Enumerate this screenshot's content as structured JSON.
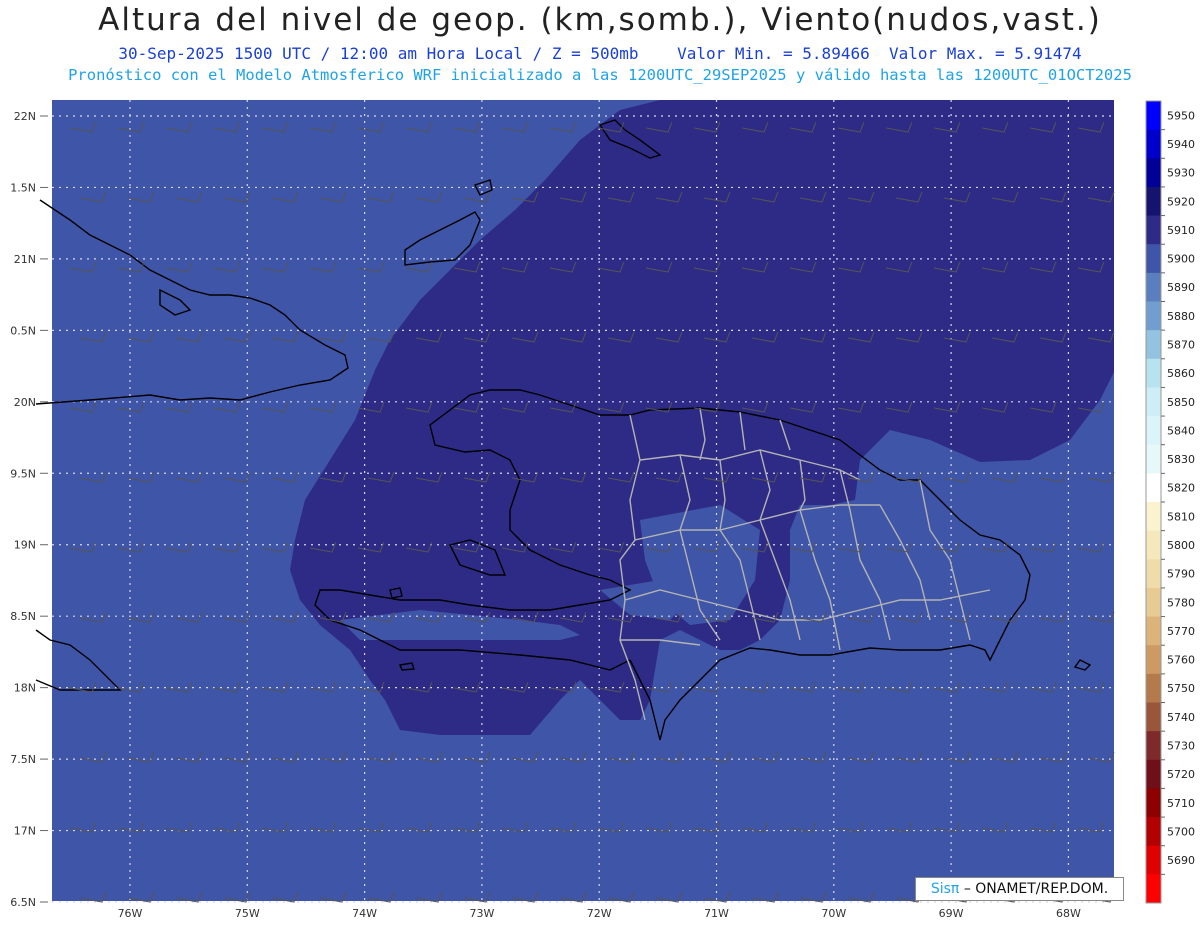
{
  "header": {
    "title": "Altura del nivel de geop. (km,somb.), Viento(nudos,vast.)",
    "subtitle_date": "30-Sep-2025  1500 UTC / 12:00 am Hora Local / Z = 500mb",
    "subtitle_min": "Valor Min. = 5.89466",
    "subtitle_max": "Valor Max. = 5.91474",
    "subtitle_model": "Pronóstico con el Modelo Atmosferico WRF inicializado a las 1200UTC_29SEP2025 y válido hasta las  1200UTC_01OCT2025"
  },
  "axes": {
    "lat_labels": [
      "22N",
      "1.5N",
      "21N",
      "0.5N",
      "20N",
      "9.5N",
      "19N",
      "8.5N",
      "18N",
      "7.5N",
      "17N",
      "6.5N"
    ],
    "lon_labels": [
      "76W",
      "75W",
      "74W",
      "73W",
      "72W",
      "71W",
      "70W",
      "69W",
      "68W"
    ]
  },
  "colorbar": {
    "levels": [
      5950,
      5940,
      5930,
      5920,
      5910,
      5900,
      5890,
      5880,
      5870,
      5860,
      5850,
      5840,
      5830,
      5820,
      5810,
      5800,
      5790,
      5780,
      5770,
      5760,
      5750,
      5740,
      5730,
      5720,
      5710,
      5700,
      5690
    ],
    "colors": [
      "#0000ff",
      "#0000cc",
      "#000099",
      "#14146e",
      "#2e2b86",
      "#3f55a8",
      "#5b7fbe",
      "#709fcf",
      "#93c3e0",
      "#b8e2ef",
      "#cdeef6",
      "#daf4f9",
      "#e7f8fb",
      "#ffffff",
      "#fbf3d0",
      "#f6e8bd",
      "#f0dcaa",
      "#e8cb92",
      "#dcb47a",
      "#cd9a63",
      "#b57a4c",
      "#9a563a",
      "#7e2a2a",
      "#6e0f1a",
      "#8c0000",
      "#b30000",
      "#e00000",
      "#ff0000"
    ]
  },
  "map_colors": {
    "low_band": "#3f55a8",
    "high_band": "#2e2b86",
    "grid": "#d8d8e8",
    "coast": "#000000",
    "dr_border": "#b3b3b3"
  },
  "credit": {
    "sis": "Sisπ",
    "org": "– ONAMET/REP.DOM."
  }
}
